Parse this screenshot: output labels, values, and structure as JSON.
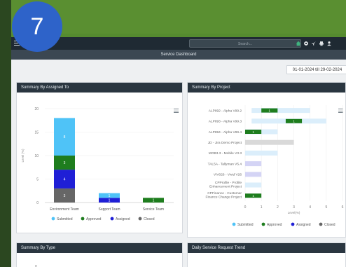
{
  "step_badge": "7",
  "navbar": {
    "search_placeholder": "Search...",
    "icons": [
      "home-icon",
      "gear-icon",
      "rocket-icon",
      "print-icon",
      "user-icon"
    ]
  },
  "subheader": {
    "title": "Service Dashboard"
  },
  "date_range": "01-01-2024 till 29-02-2024",
  "colors": {
    "submitted": "#4fc3f7",
    "approved": "#1e7d1e",
    "assigned": "#1f1fd6",
    "closed": "#666666",
    "submitted_light": "#dbeefb",
    "closed_light": "#d9d9d9",
    "assigned_light": "#d4d4f5"
  },
  "cards": {
    "assigned": {
      "title": "Summary By Assigned To"
    },
    "project": {
      "title": "Summary By Project"
    },
    "type": {
      "title": "Summary By Type"
    },
    "trend": {
      "title": "Daily Service Request Trend"
    }
  },
  "legend": [
    "Submitted",
    "Approved",
    "Assigned",
    "Closed"
  ],
  "chart_data": [
    {
      "type": "bar",
      "stacked": true,
      "categories": [
        "Environment Team",
        "Support Team",
        "Service Team"
      ],
      "series": [
        {
          "name": "Closed",
          "values": [
            3,
            0,
            0
          ]
        },
        {
          "name": "Assigned",
          "values": [
            4,
            1,
            0
          ]
        },
        {
          "name": "Approved",
          "values": [
            3,
            0,
            1
          ]
        },
        {
          "name": "Submitted",
          "values": [
            8,
            1,
            0
          ]
        }
      ],
      "data_labels": [
        [
          "3",
          "4",
          "3",
          "8"
        ],
        [],
        [
          "1"
        ]
      ],
      "ylabel": "Level (%)",
      "ylim": [
        0,
        20
      ],
      "yticks": [
        "0",
        "5",
        "10",
        "15",
        "20"
      ]
    },
    {
      "type": "bar",
      "orientation": "horizontal",
      "categories": [
        "ALP892 - Alpha V99.2",
        "ALP893 - Alpha V99.3",
        "ALP894 - Alpha V99.4",
        "JD - Jira Demo Project",
        "MOB3.3 - Mobile V3.3",
        "TAL5A - Tallyman V5.4",
        "VIV026 - Vivid V26",
        "CPProfile - Profile Enhancement Project",
        "CPFinance - Customer Finance Change Project"
      ],
      "segments": [
        [
          {
            "status": "submitted",
            "start": 0.4,
            "end": 4.0
          },
          {
            "status": "approved",
            "start": 1.0,
            "end": 2.0,
            "label": "1"
          }
        ],
        [
          {
            "status": "submitted",
            "start": 0.4,
            "end": 5.0
          },
          {
            "status": "approved",
            "start": 2.5,
            "end": 3.5,
            "label": "1"
          }
        ],
        [
          {
            "status": "submitted",
            "start": 0.0,
            "end": 2.0
          },
          {
            "status": "approved",
            "start": 0.0,
            "end": 1.0,
            "label": "1"
          }
        ],
        [
          {
            "status": "closed",
            "start": 0.0,
            "end": 3.0
          }
        ],
        [
          {
            "status": "submitted",
            "start": 0.0,
            "end": 2.0
          }
        ],
        [
          {
            "status": "assigned",
            "start": 0.0,
            "end": 1.0
          }
        ],
        [
          {
            "status": "assigned",
            "start": 0.0,
            "end": 1.0
          }
        ],
        [
          {
            "status": "submitted",
            "start": 0.0,
            "end": 1.0
          }
        ],
        [
          {
            "status": "approved",
            "start": 0.0,
            "end": 1.0,
            "label": "1"
          }
        ]
      ],
      "xticks": [
        "0",
        "1",
        "2",
        "3",
        "4",
        "5",
        "6"
      ],
      "xlim": [
        0,
        6
      ],
      "xlabel": "Level(%)"
    }
  ],
  "type_chart": {
    "ytick": "8"
  }
}
